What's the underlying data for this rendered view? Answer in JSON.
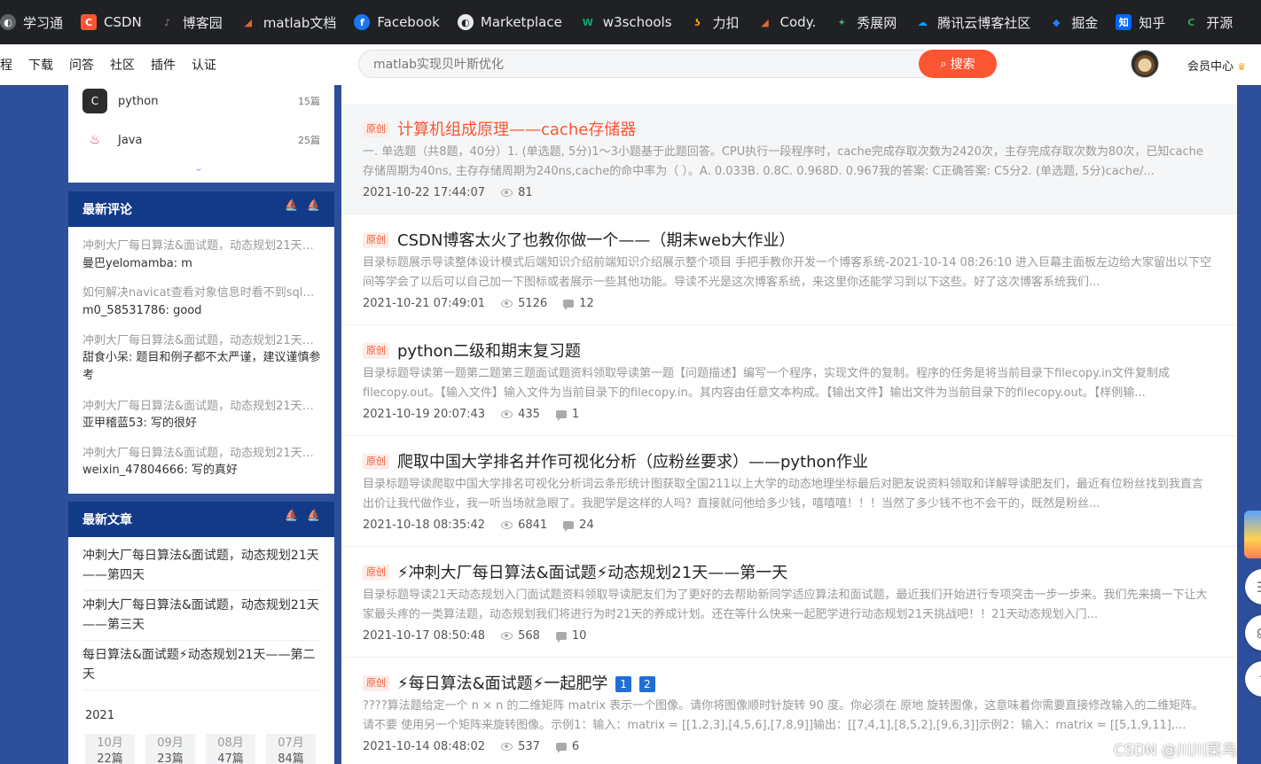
{
  "bookmarks": [
    {
      "label": "学习通",
      "icon": "globe-icon",
      "color": "#5f6368"
    },
    {
      "label": "CSDN",
      "icon": "csdn-icon",
      "color": "#fc5531"
    },
    {
      "label": "博客园",
      "icon": "cnblogs-icon",
      "color": "#555555"
    },
    {
      "label": "matlab文档",
      "icon": "matlab-icon",
      "color": "#e16737"
    },
    {
      "label": "Facebook",
      "icon": "facebook-icon",
      "color": "#1877f2"
    },
    {
      "label": "Marketplace",
      "icon": "globe-icon",
      "color": "#5f6368"
    },
    {
      "label": "w3schools",
      "icon": "w3schools-icon",
      "color": "#04aa6d"
    },
    {
      "label": "力扣",
      "icon": "leetcode-icon",
      "color": "#ffa116"
    },
    {
      "label": "Cody.",
      "icon": "matlab-icon",
      "color": "#e16737"
    },
    {
      "label": "秀展网",
      "icon": "xiuzhan-icon",
      "color": "#2e8b57"
    },
    {
      "label": "腾讯云博客社区",
      "icon": "tencent-cloud-icon",
      "color": "#00a3ff"
    },
    {
      "label": "掘金",
      "icon": "juejin-icon",
      "color": "#1e80ff"
    },
    {
      "label": "知乎",
      "icon": "zhihu-icon",
      "color": "#0066ff"
    },
    {
      "label": "开源",
      "icon": "gitee-icon",
      "color": "#2ea44f"
    }
  ],
  "nav": {
    "links": [
      "程",
      "下载",
      "问答",
      "社区",
      "插件",
      "认证"
    ],
    "search_value": "matlab实现贝叶斯优化",
    "search_button": "搜索",
    "member": "会员中心"
  },
  "categories": [
    {
      "name": "python",
      "count": "15篇"
    },
    {
      "name": "Java",
      "count": "25篇"
    }
  ],
  "latest_comments": {
    "heading": "最新评论",
    "items": [
      {
        "title": "冲刺大厂每日算法&面试题，动态规划21天——第四天",
        "body": "曼巴yelomamba: m"
      },
      {
        "title": "如何解决navicat查看对象信息时看不到sql语句",
        "body": "m0_58531786: good"
      },
      {
        "title": "冲刺大厂每日算法&面试题，动态规划21天——第三天",
        "body": "甜食小呆: 题目和例子都不太严谨，建议谨慎参考"
      },
      {
        "title": "冲刺大厂每日算法&面试题，动态规划21天——第二天",
        "body": "亚甲稽蓝53: 写的很好"
      },
      {
        "title": "冲刺大厂每日算法&面试题，动态规划21天——第一天",
        "body": "weixin_47804666: 写的真好"
      }
    ]
  },
  "latest_articles": {
    "heading": "最新文章",
    "items": [
      "冲刺大厂每日算法&面试题，动态规划21天——第四天",
      "冲刺大厂每日算法&面试题，动态规划21天——第三天",
      "每日算法&面试题⚡动态规划21天——第二天"
    ]
  },
  "archive": {
    "year": "2021",
    "months": [
      {
        "month": "10月",
        "count": "22篇"
      },
      {
        "month": "09月",
        "count": "23篇"
      },
      {
        "month": "08月",
        "count": "47篇"
      },
      {
        "month": "07月",
        "count": "84篇"
      }
    ]
  },
  "partial_meta": "2021-10-22 17:44:07",
  "posts": [
    {
      "tag": "原创",
      "title": "计算机组成原理——cache存储器",
      "desc": "一. 单选题（共8题，40分）1. (单选题, 5分)1～3小题基于此题回答。CPU执行一段程序时，cache完成存取次数为2420次，主存完成存取次数为80次，已知cache存储周期为40ns, 主存存储周期为240ns,cache的命中率为（ ）。A. 0.033B. 0.8C. 0.968D. 0.967我的答案: C正确答案: C5分2. (单选题, 5分)cache/...",
      "date": "2021-10-22 17:44:07",
      "views": "81",
      "comments": ""
    },
    {
      "tag": "原创",
      "title": "CSDN博客太火了也教你做一个——（期末web大作业）",
      "desc": "目录标题展示导读整体设计模式后端知识介绍前端知识介绍展示整个项目 手把手教你开发一个博客系统-2021-10-14 08:26:10 进入巨幕主面板左边给大家留出以下空间等学会了以后可以自己加一下图标或者展示一些其他功能。导读不光是这次博客系统，来这里你还能学习到以下这些。好了这次博客系统我们...",
      "date": "2021-10-21 07:49:01",
      "views": "5126",
      "comments": "12"
    },
    {
      "tag": "原创",
      "title": "python二级和期末复习题",
      "desc": "目录标题导读第一题第二题第三题面试题资料领取导读第一题【问题描述】编写一个程序，实现文件的复制。程序的任务是将当前目录下filecopy.in文件复制成filecopy.out。【输入文件】输入文件为当前目录下的filecopy.in。其内容由任意文本构成。【输出文件】输出文件为当前目录下的filecopy.out。【样例输...",
      "date": "2021-10-19 20:07:43",
      "views": "435",
      "comments": "1"
    },
    {
      "tag": "原创",
      "title": "爬取中国大学排名并作可视化分析（应粉丝要求）——python作业",
      "desc": "目录标题导读爬取中国大学排名可视化分析词云条形统计图获取全国211以上大学的动态地理坐标最后对肥友说资料领取和详解导读肥友们，最近有位粉丝找到我直言出价让我代做作业，我一听当场就急眼了。我肥学是这样的人吗？直接就问他给多少钱，嘻嘻嘻！！！当然了多少钱不也不会干的，既然是粉丝...",
      "date": "2021-10-18 08:35:42",
      "views": "6841",
      "comments": "24"
    },
    {
      "tag": "原创",
      "title": "⚡冲刺大厂每日算法&面试题⚡动态规划21天——第一天",
      "desc": "目录标题导读21天动态规划入门面试题资料领取导读肥友们为了更好的去帮助新同学适应算法和面试题，最近我们开始进行专项突击一步一步来。我们先来搞一下让大家最头疼的一类算法题，动态规划我们将进行为时21天的养成计划。还在等什么快来一起肥学进行动态规划21天挑战吧！！21天动态规划入门...",
      "date": "2021-10-17 08:50:48",
      "views": "568",
      "comments": "10"
    },
    {
      "tag": "原创",
      "title": "⚡每日算法&面试题⚡一起肥学",
      "badges": [
        "1",
        "2"
      ],
      "desc": "????算法题给定一个 n × n 的二维矩阵 matrix 表示一个图像。请你将图像顺时针旋转 90 度。你必须在 原地 旋转图像，这意味着你需要直接修改输入的二维矩阵。请不要 使用另一个矩阵来旋转图像。示例1：输入：matrix = [[1,2,3],[4,5,6],[7,8,9]]输出：[[7,4,1],[8,5,2],[9,6,3]]示例2：输入：matrix = [[5,1,9,11],...",
      "date": "2021-10-14 08:48:02",
      "views": "537",
      "comments": "6"
    }
  ],
  "watermark": "CSDN @川川菜鸟"
}
